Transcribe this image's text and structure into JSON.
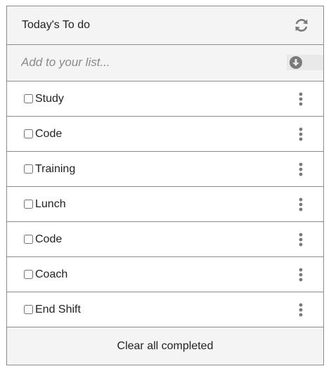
{
  "header": {
    "title": "Today's To do",
    "refresh_icon": "refresh-icon"
  },
  "add_form": {
    "placeholder": "Add to your list...",
    "value": "",
    "submit_icon": "circle-arrow-down-icon"
  },
  "items": [
    {
      "label": "Study",
      "checked": false
    },
    {
      "label": "Code",
      "checked": false
    },
    {
      "label": "Training",
      "checked": false
    },
    {
      "label": "Lunch",
      "checked": false
    },
    {
      "label": "Code",
      "checked": false
    },
    {
      "label": "Coach",
      "checked": false
    },
    {
      "label": "End Shift",
      "checked": false
    }
  ],
  "item_menu_icon": "kebab-menu-icon",
  "footer": {
    "clear_label": "Clear all completed"
  },
  "colors": {
    "border": "#8c8c8c",
    "header_bg": "#f4f4f4",
    "icon": "#7a7a7a",
    "text": "#222222",
    "placeholder": "#8a8a8a"
  }
}
